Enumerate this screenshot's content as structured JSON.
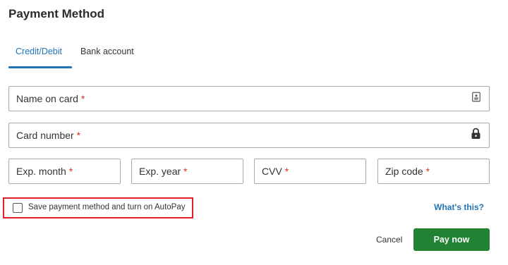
{
  "title": "Payment Method",
  "tabs": [
    {
      "label": "Credit/Debit",
      "active": true
    },
    {
      "label": "Bank account",
      "active": false
    }
  ],
  "fields": {
    "name_on_card": {
      "label": "Name on card",
      "required": "*",
      "value": "",
      "icon": "contact-card-icon"
    },
    "card_number": {
      "label": "Card number",
      "required": "*",
      "value": "",
      "icon": "lock-icon"
    },
    "exp_month": {
      "label": "Exp. month",
      "required": "*",
      "value": ""
    },
    "exp_year": {
      "label": "Exp. year",
      "required": "*",
      "value": ""
    },
    "cvv": {
      "label": "CVV",
      "required": "*",
      "value": ""
    },
    "zip_code": {
      "label": "Zip code",
      "required": "*",
      "value": ""
    }
  },
  "autopay": {
    "label": "Save payment method and turn on AutoPay",
    "checked": false
  },
  "whats_this": "What's this?",
  "actions": {
    "cancel": "Cancel",
    "pay": "Pay now"
  },
  "colors": {
    "accent": "#1f74b8",
    "required": "#d93025",
    "pay_button": "#218233",
    "highlight": "#e01f26"
  }
}
